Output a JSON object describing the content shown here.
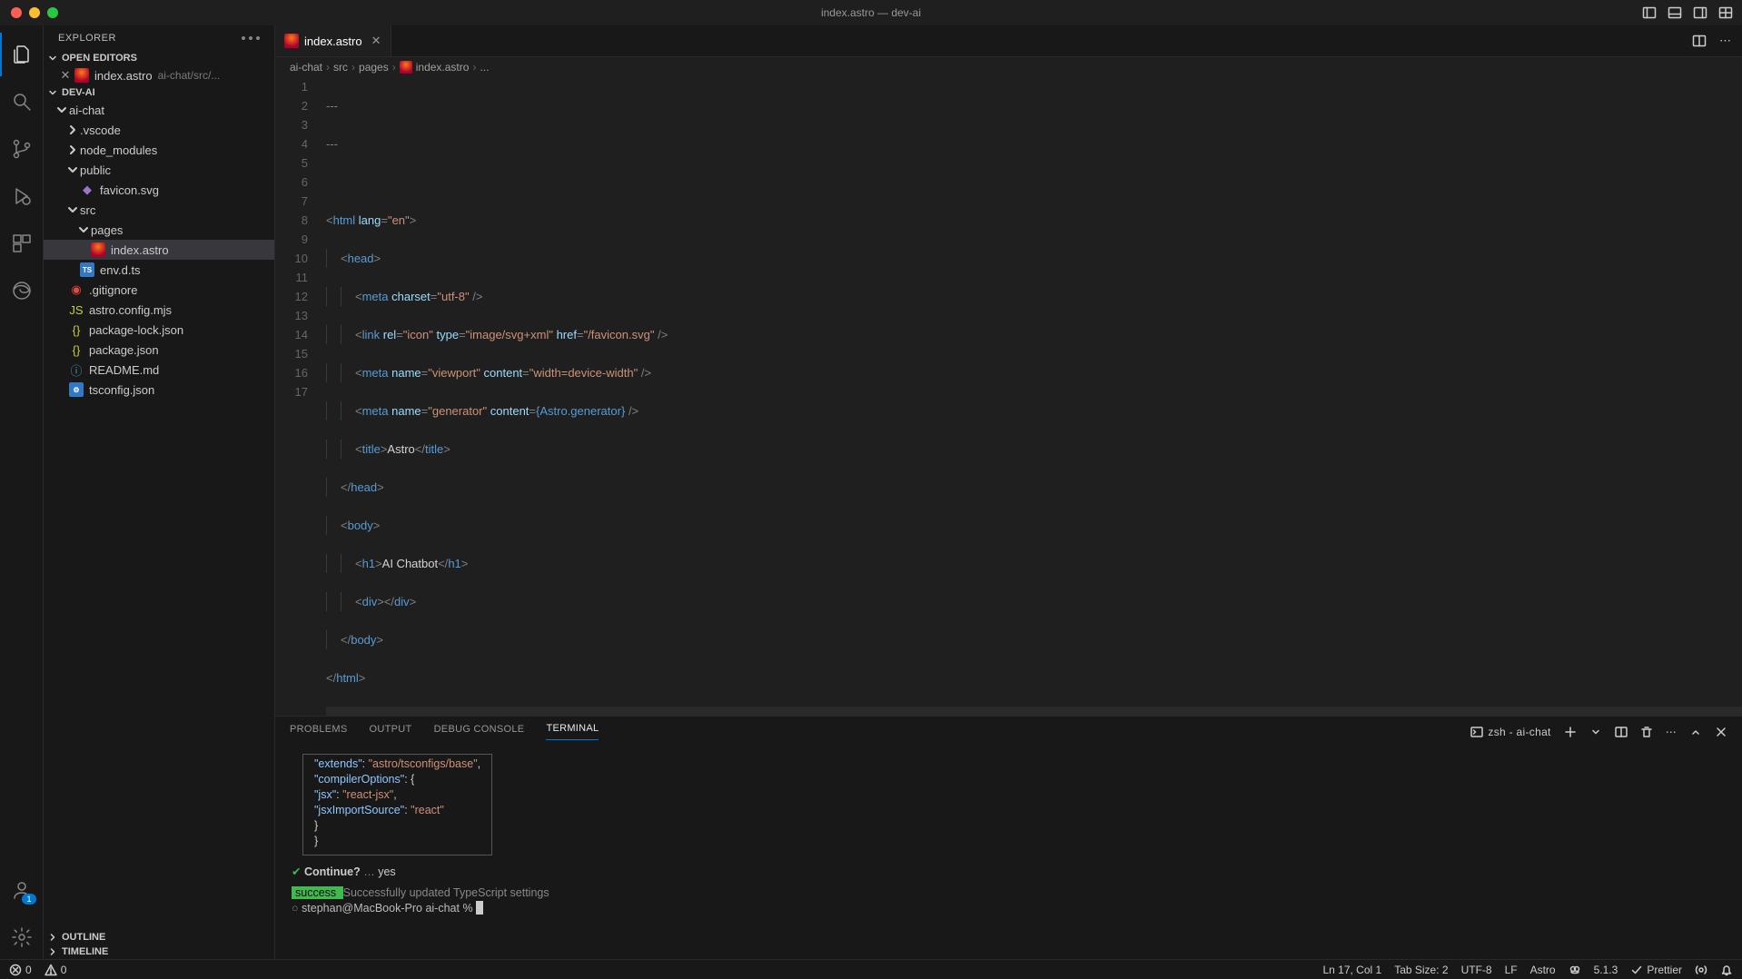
{
  "window": {
    "title": "index.astro — dev-ai"
  },
  "explorer": {
    "title": "EXPLORER",
    "sections": {
      "open_editors": "OPEN EDITORS",
      "workspace": "DEV-AI",
      "outline": "OUTLINE",
      "timeline": "TIMELINE"
    },
    "open_editor": {
      "name": "index.astro",
      "detail": "ai-chat/src/..."
    },
    "tree": {
      "root": "ai-chat",
      "folders": {
        "vscode": ".vscode",
        "node_modules": "node_modules",
        "public": "public",
        "src": "src",
        "pages": "pages"
      },
      "files": {
        "favicon": "favicon.svg",
        "index": "index.astro",
        "envdts": "env.d.ts",
        "gitignore": ".gitignore",
        "astrocfg": "astro.config.mjs",
        "pkglock": "package-lock.json",
        "pkg": "package.json",
        "readme": "README.md",
        "tsconfig": "tsconfig.json"
      }
    }
  },
  "tab": {
    "name": "index.astro"
  },
  "breadcrumbs": {
    "p0": "ai-chat",
    "p1": "src",
    "p2": "pages",
    "p3": "index.astro",
    "p4": "..."
  },
  "editor": {
    "lines": [
      "1",
      "2",
      "3",
      "4",
      "5",
      "6",
      "7",
      "8",
      "9",
      "10",
      "11",
      "12",
      "13",
      "14",
      "15",
      "16",
      "17"
    ],
    "code": {
      "l1": "---",
      "l2": "---",
      "l4_tag": "html",
      "l4_attr": "lang",
      "l4_val": "\"en\"",
      "l5_tag": "head",
      "l6_tag": "meta",
      "l6_attr": "charset",
      "l6_val": "\"utf-8\"",
      "l7_tag": "link",
      "l7_a1": "rel",
      "l7_v1": "\"icon\"",
      "l7_a2": "type",
      "l7_v2": "\"image/svg+xml\"",
      "l7_a3": "href",
      "l7_v3": "\"/favicon.svg\"",
      "l8_tag": "meta",
      "l8_a1": "name",
      "l8_v1": "\"viewport\"",
      "l8_a2": "content",
      "l8_v2": "\"width=device-width\"",
      "l9_tag": "meta",
      "l9_a1": "name",
      "l9_v1": "\"generator\"",
      "l9_a2": "content",
      "l9_v2": "{Astro.generator}",
      "l10_open": "title",
      "l10_txt": "Astro",
      "l10_close": "title",
      "l11": "head",
      "l12": "body",
      "l13_open": "h1",
      "l13_txt": "AI Chatbot",
      "l13_close": "h1",
      "l14_open": "div",
      "l14_close": "div",
      "l15": "body",
      "l16": "html"
    }
  },
  "panel": {
    "tabs": {
      "problems": "PROBLEMS",
      "output": "OUTPUT",
      "debug": "DEBUG CONSOLE",
      "terminal": "TERMINAL"
    },
    "shell": "zsh - ai-chat",
    "terminal": {
      "json": {
        "k1": "\"extends\"",
        "v1": "\"astro/tsconfigs/base\"",
        "k2": "\"compilerOptions\"",
        "k3": "\"jsx\"",
        "v3": "\"react-jsx\"",
        "k4": "\"jsxImportSource\"",
        "v4": "\"react\""
      },
      "continue_q": "Continue?",
      "continue_dots": "…",
      "continue_a": "yes",
      "success_badge": " success ",
      "success_msg": "Successfully updated TypeScript settings",
      "prompt_user": "stephan@MacBook-Pro",
      "prompt_dir": "ai-chat",
      "prompt_sym": "%"
    }
  },
  "status": {
    "errors": "0",
    "warnings": "0",
    "cursor": "Ln 17, Col 1",
    "tabsize": "Tab Size: 2",
    "encoding": "UTF-8",
    "eol": "LF",
    "lang": "Astro",
    "version": "5.1.3",
    "prettier": "Prettier"
  }
}
